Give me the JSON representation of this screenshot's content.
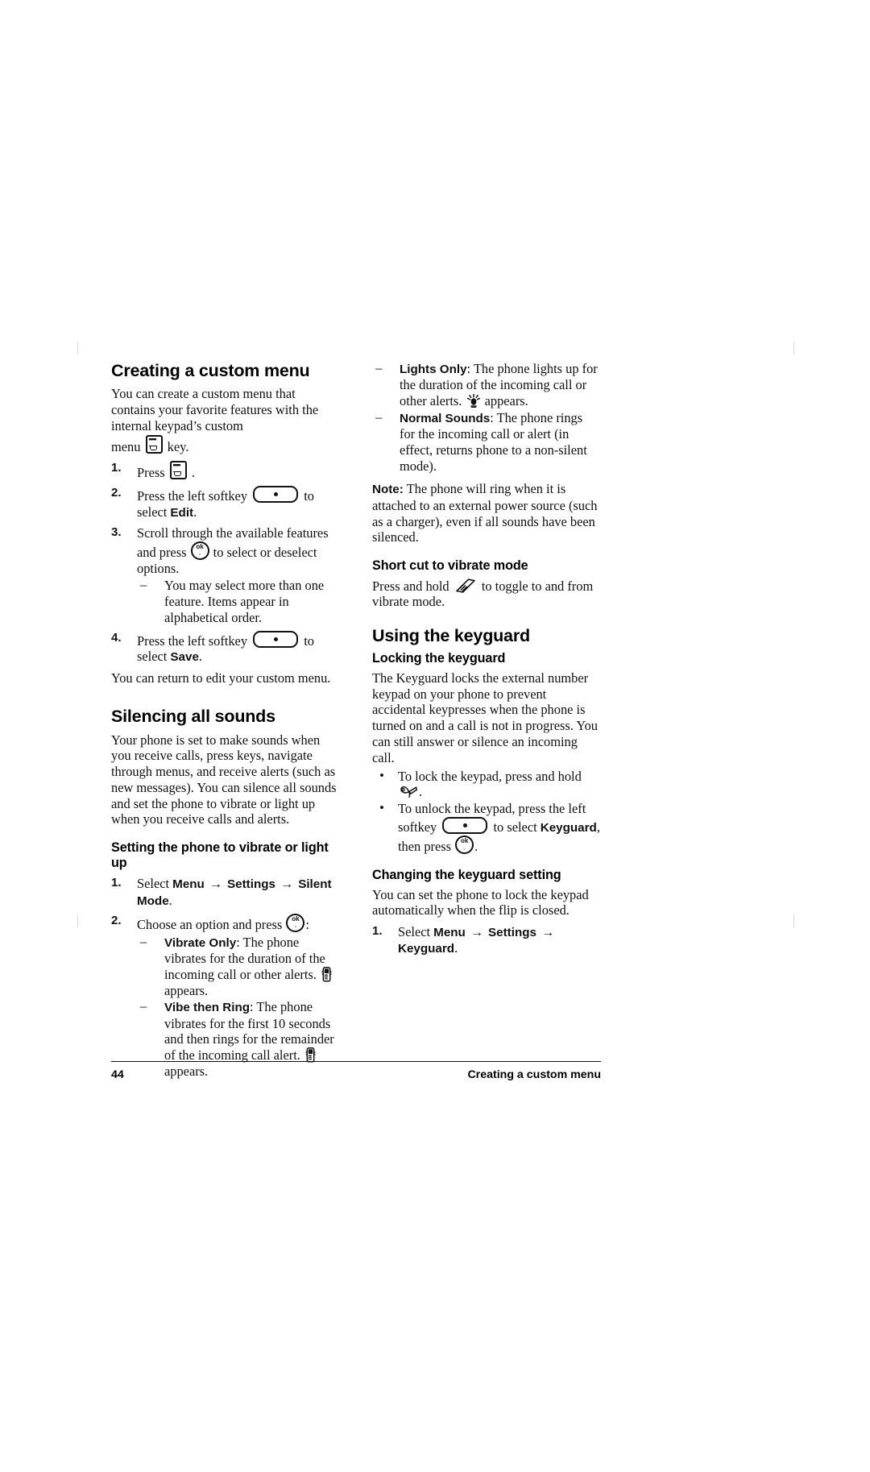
{
  "page": {
    "number": "44",
    "footer_title": "Creating a custom menu"
  },
  "left_column": {
    "section1": {
      "heading": "Creating a custom menu",
      "intro_1": "You can create a custom menu that contains your",
      "intro_2": "favorite features with the internal keypad’s custom",
      "intro_3_pre": "menu",
      "intro_3_post": "key.",
      "steps": [
        {
          "num": "1.",
          "pre": "Press",
          "icon": "menu-key-icon",
          "post": "."
        },
        {
          "num": "2.",
          "pre": "Press the left softkey",
          "icon": "softkey-icon",
          "mid": "to select",
          "ui": "Edit",
          "post": "."
        },
        {
          "num": "3.",
          "pre": "Scroll through the available features and press",
          "icon": "ok-key-icon",
          "post": "to select or deselect options.",
          "subitems": [
            "You may select more than one feature.",
            "Items appear in alphabetical order."
          ]
        },
        {
          "num": "4.",
          "pre": "Press the left softkey",
          "icon": "softkey-icon",
          "mid": "to select",
          "ui": "Save",
          "post": "."
        }
      ],
      "closing": "You can return to edit your custom menu."
    },
    "section2": {
      "heading": "Silencing all sounds",
      "para_lines": [
        "Your phone is set to make sounds when you",
        "receive calls, press keys, navigate through menus,",
        "and receive alerts (such as new messages). You",
        "can silence all sounds and set the phone to vibrate",
        "or light up when you receive calls and alerts."
      ],
      "subheading": "Setting the phone to vibrate or light up",
      "steps": [
        {
          "num": "1.",
          "pre": "Select",
          "ui1": "Menu",
          "arrow1": "→",
          "ui2": "Settings",
          "arrow2": "→",
          "ui3": "Silent Mode",
          "post": "."
        },
        {
          "num": "2.",
          "pre": "Choose an option and press",
          "icon": "ok-key-icon",
          "post": ":"
        }
      ],
      "options": [
        {
          "label": "Vibrate Only",
          "text_lines": [
            ": The phone vibrates for the",
            "duration of the incoming call or other",
            "alerts."
          ],
          "icon": "vibrate-icon",
          "tail": "appears."
        },
        {
          "label": "Vibe then Ring",
          "text_lines": [
            ": The phone vibrates for the",
            "first 10 seconds and then rings for the",
            "remainder of the incoming call alert."
          ],
          "icon": "vibrate-icon",
          "tail": "appears."
        }
      ]
    }
  },
  "right_column": {
    "options_continued": [
      {
        "label": "Lights Only",
        "text_lines": [
          ": The phone lights up for the",
          "duration of the incoming call or other",
          "alerts."
        ],
        "icon": "lights-icon",
        "tail": "appears."
      },
      {
        "label": "Normal Sounds",
        "text_lines": [
          ": The phone rings for the",
          "incoming call or alert (in effect, returns",
          "phone to a non-silent mode)."
        ]
      }
    ],
    "note": {
      "label": "Note:",
      "lines": [
        "The phone will ring when it is attached to",
        "an external power source (such as a charger),",
        "even if all sounds have been silenced."
      ]
    },
    "section_shortcut": {
      "subheading": "Short cut to vibrate mode",
      "pre": "Press and hold",
      "icon": "vibrate-shortcut-key-icon",
      "mid": "to toggle to and from",
      "post": "vibrate mode."
    },
    "section_keyguard": {
      "heading": "Using the keyguard",
      "subheading_lock": "Locking the keyguard",
      "para_lines": [
        "The Keyguard locks the external number keypad",
        "on your phone to prevent accidental keypresses",
        "when the phone is turned on and a call is not in",
        "progress. You can still answer or silence an",
        "incoming call."
      ],
      "bullets": [
        {
          "pre": "To lock the keypad, press and hold",
          "icon": "lock-key-icon",
          "post": "."
        },
        {
          "pre": "To unlock the keypad, press the left softkey",
          "icon": "softkey-icon",
          "mid": "to select",
          "ui": "Keyguard",
          "mid2": ", then press",
          "icon2": "ok-key-icon",
          "post": "."
        }
      ],
      "subheading_change": "Changing the keyguard setting",
      "change_lines": [
        "You can set the phone to lock the keypad",
        "automatically when the flip is closed."
      ],
      "change_step": {
        "num": "1.",
        "pre": "Select",
        "ui1": "Menu",
        "arrow1": "→",
        "ui2": "Settings",
        "arrow2": "→",
        "ui3": "Keyguard",
        "post": "."
      }
    }
  },
  "colors": {
    "text": "#111111",
    "rule": "#111111",
    "background": "#ffffff"
  }
}
